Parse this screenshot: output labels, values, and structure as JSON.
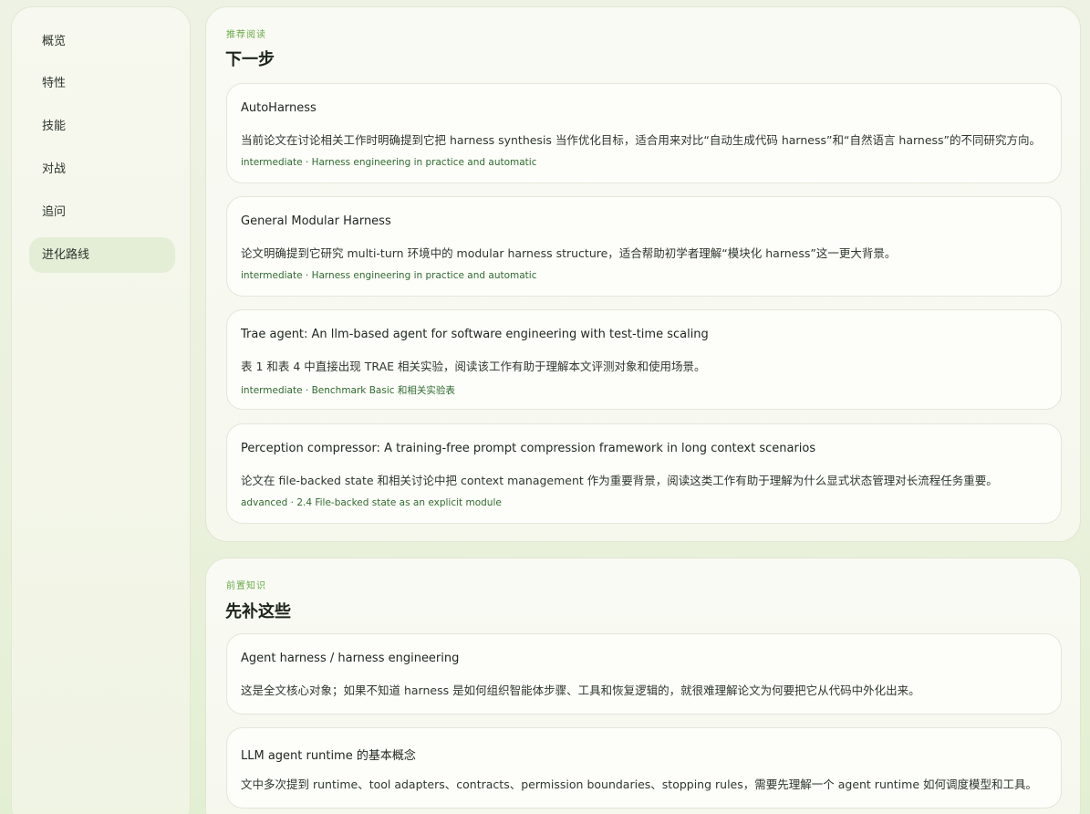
{
  "sidebar": {
    "items": [
      {
        "label": "概览"
      },
      {
        "label": "特性"
      },
      {
        "label": "技能"
      },
      {
        "label": "对战"
      },
      {
        "label": "追问"
      },
      {
        "label": "进化路线"
      }
    ],
    "active_label": "进化路线"
  },
  "next_steps": {
    "eyebrow": "推荐阅读",
    "title": "下一步",
    "cards": [
      {
        "title": "AutoHarness",
        "desc": "当前论文在讨论相关工作时明确提到它把 harness synthesis 当作优化目标，适合用来对比“自动生成代码 harness”和“自然语言 harness”的不同研究方向。",
        "meta": "intermediate · Harness engineering in practice and automatic"
      },
      {
        "title": "General Modular Harness",
        "desc": "论文明确提到它研究 multi-turn 环境中的 modular harness structure，适合帮助初学者理解“模块化 harness”这一更大背景。",
        "meta": "intermediate · Harness engineering in practice and automatic"
      },
      {
        "title": "Trae agent: An llm-based agent for software engineering with test-time scaling",
        "desc": "表 1 和表 4 中直接出现 TRAE 相关实验，阅读该工作有助于理解本文评测对象和使用场景。",
        "meta": "intermediate · Benchmark Basic 和相关实验表"
      },
      {
        "title": "Perception compressor: A training-free prompt compression framework in long context scenarios",
        "desc": "论文在 file-backed state 和相关讨论中把 context management 作为重要背景，阅读这类工作有助于理解为什么显式状态管理对长流程任务重要。",
        "meta": "advanced · 2.4 File-backed state as an explicit module"
      }
    ]
  },
  "prerequisites": {
    "eyebrow": "前置知识",
    "title": "先补这些",
    "cards": [
      {
        "title": "Agent harness / harness engineering",
        "desc": "这是全文核心对象；如果不知道 harness 是如何组织智能体步骤、工具和恢复逻辑的，就很难理解论文为何要把它从代码中外化出来。"
      },
      {
        "title": "LLM agent runtime 的基本概念",
        "desc": "文中多次提到 runtime、tool adapters、contracts、permission boundaries、stopping rules，需要先理解一个 agent runtime 如何调度模型和工具。"
      }
    ]
  }
}
